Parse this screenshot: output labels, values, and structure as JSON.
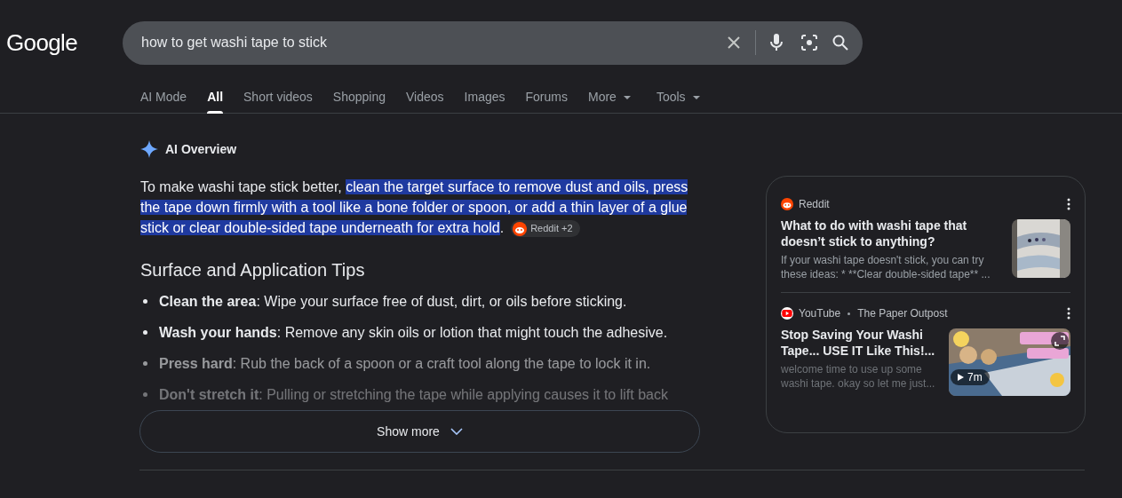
{
  "logo": "Google",
  "search": {
    "value": "how to get washi tape to stick"
  },
  "tabs": [
    {
      "label": "AI Mode",
      "selected": false,
      "dropdown": false
    },
    {
      "label": "All",
      "selected": true,
      "dropdown": false
    },
    {
      "label": "Short videos",
      "selected": false,
      "dropdown": false
    },
    {
      "label": "Shopping",
      "selected": false,
      "dropdown": false
    },
    {
      "label": "Videos",
      "selected": false,
      "dropdown": false
    },
    {
      "label": "Images",
      "selected": false,
      "dropdown": false
    },
    {
      "label": "Forums",
      "selected": false,
      "dropdown": false
    },
    {
      "label": "More",
      "selected": false,
      "dropdown": true
    },
    {
      "label": "Tools",
      "selected": false,
      "dropdown": true
    }
  ],
  "ai_overview": {
    "title": "AI Overview",
    "summary": {
      "text": "To make washi tape stick better, ",
      "highlighted": "clean the target surface to remove dust and oils, press the tape down firmly with a tool like a bone folder or spoon, or add a thin layer of a glue stick or clear double-sided tape underneath for extra hold",
      "end": ".",
      "source_chip": "Reddit +2"
    },
    "heading": "Surface and Application Tips",
    "tips": [
      "**Clean the area**: Wipe your surface free of dust, dirt, or oils before sticking.",
      "**Wash your hands**: Remove any skin oils or lotion that might touch the adhesive.",
      "**Press hard**: Rub the back of a spoon or a craft tool along the tape to lock it in.",
      "**Don't stretch it**: Pulling or stretching the tape while applying causes it to lift back"
    ],
    "show_more": "Show more"
  },
  "sources": [
    {
      "kind": "reddit",
      "source": "Reddit",
      "title": "What to do with washi tape that doesn’t stick to anything?",
      "snippet": "If your washi tape doesn't stick, you can try these ideas: * **Clear double-sided tape** ..."
    },
    {
      "kind": "youtube",
      "source": "YouTube",
      "channel": "The Paper Outpost",
      "title": "Stop Saving Your Washi Tape... USE IT Like This!...",
      "snippet": "welcome time to use up some washi tape. okay so let me just...",
      "duration": "7m"
    }
  ]
}
